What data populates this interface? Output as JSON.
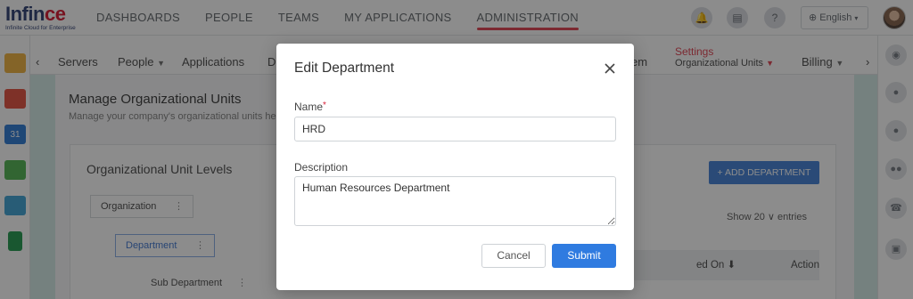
{
  "logo": {
    "brand_a": "Inf",
    "brand_b": "in",
    "brand_c": "ce",
    "tagline": "Infinite Cloud for Enterprise"
  },
  "nav": {
    "items": [
      "DASHBOARDS",
      "PEOPLE",
      "TEAMS",
      "MY APPLICATIONS",
      "ADMINISTRATION"
    ],
    "active": "ADMINISTRATION"
  },
  "topbar": {
    "language": "English",
    "icons": [
      "bell-icon",
      "clipboard-icon",
      "help-icon"
    ]
  },
  "subnav": {
    "items": [
      "Servers",
      "People",
      "Applications",
      "D",
      "em",
      "Billing"
    ],
    "settings_label": "Settings",
    "settings_sub": "Organizational Units"
  },
  "page": {
    "title": "Manage Organizational Units",
    "subtitle": "Manage your company's organizational units he",
    "card_title": "Organizational Unit Levels",
    "tree": [
      "Organization",
      "Department",
      "Sub Department"
    ],
    "add_button": "+ ADD DEPARTMENT",
    "show_entries": "Show  20   ∨  entries",
    "table_headers": [
      "ed On ⬇",
      "Action"
    ]
  },
  "modal": {
    "title": "Edit Department",
    "name_label": "Name",
    "name_required": "*",
    "name_value": "HRD",
    "description_label": "Description",
    "description_value": "Human Resources Department",
    "cancel_label": "Cancel",
    "submit_label": "Submit"
  },
  "colors": {
    "accent": "#2f7be0",
    "nav_underline": "#e24b5a",
    "required": "#d9233b"
  }
}
